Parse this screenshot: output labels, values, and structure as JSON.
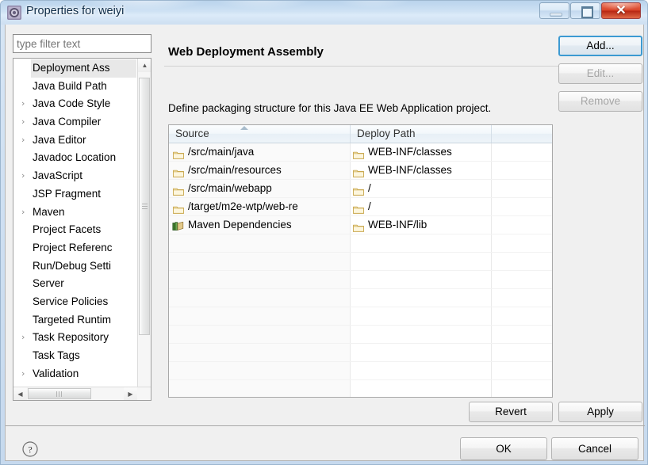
{
  "window": {
    "title": "Properties for weiyi",
    "icon": "eclipse-properties-icon",
    "controls": {
      "minimize": "minimize-button",
      "maximize": "maximize-button",
      "close": "✕"
    }
  },
  "sidebar": {
    "filter": {
      "value": "",
      "placeholder": "type filter text"
    },
    "items": [
      {
        "label": "Deployment Ass",
        "expandable": false,
        "selected": true
      },
      {
        "label": "Java Build Path",
        "expandable": false,
        "selected": false
      },
      {
        "label": "Java Code Style",
        "expandable": true,
        "selected": false
      },
      {
        "label": "Java Compiler",
        "expandable": true,
        "selected": false
      },
      {
        "label": "Java Editor",
        "expandable": true,
        "selected": false
      },
      {
        "label": "Javadoc Location",
        "expandable": false,
        "selected": false
      },
      {
        "label": "JavaScript",
        "expandable": true,
        "selected": false
      },
      {
        "label": "JSP Fragment",
        "expandable": false,
        "selected": false
      },
      {
        "label": "Maven",
        "expandable": true,
        "selected": false
      },
      {
        "label": "Project Facets",
        "expandable": false,
        "selected": false
      },
      {
        "label": "Project Referenc",
        "expandable": false,
        "selected": false
      },
      {
        "label": "Run/Debug Setti",
        "expandable": false,
        "selected": false
      },
      {
        "label": "Server",
        "expandable": false,
        "selected": false
      },
      {
        "label": "Service Policies",
        "expandable": false,
        "selected": false
      },
      {
        "label": "Targeted Runtim",
        "expandable": false,
        "selected": false
      },
      {
        "label": "Task Repository",
        "expandable": true,
        "selected": false
      },
      {
        "label": "Task Tags",
        "expandable": false,
        "selected": false
      },
      {
        "label": "Validation",
        "expandable": true,
        "selected": false
      }
    ]
  },
  "main": {
    "title": "Web Deployment Assembly",
    "description": "Define packaging structure for this Java EE Web Application project.",
    "nav": {
      "back": "back-arrow-icon",
      "back_menu": "▼",
      "forward": "forward-arrow-icon",
      "forward_menu": "▼",
      "view_menu": "▼"
    },
    "table": {
      "columns": [
        "Source",
        "Deploy Path",
        ""
      ],
      "sort_column": "Source",
      "sort_direction": "ascending",
      "rows": [
        {
          "source": "/src/main/java",
          "source_icon": "folder-icon",
          "deploy": "WEB-INF/classes",
          "deploy_icon": "folder-icon"
        },
        {
          "source": "/src/main/resources",
          "source_icon": "folder-icon",
          "deploy": "WEB-INF/classes",
          "deploy_icon": "folder-icon"
        },
        {
          "source": "/src/main/webapp",
          "source_icon": "folder-icon",
          "deploy": "/",
          "deploy_icon": "folder-icon"
        },
        {
          "source": "/target/m2e-wtp/web-re",
          "source_icon": "folder-icon",
          "deploy": "/",
          "deploy_icon": "folder-icon"
        },
        {
          "source": "Maven Dependencies",
          "source_icon": "library-icon",
          "deploy": "WEB-INF/lib",
          "deploy_icon": "folder-icon"
        }
      ],
      "empty_row_count": 10
    },
    "actions": {
      "add": {
        "label": "Add...",
        "enabled": true,
        "focused": true
      },
      "edit": {
        "label": "Edit...",
        "enabled": false
      },
      "remove": {
        "label": "Remove",
        "enabled": false
      }
    },
    "page_buttons": {
      "revert": "Revert",
      "apply": "Apply"
    }
  },
  "footer": {
    "help": "?",
    "ok": "OK",
    "cancel": "Cancel"
  }
}
